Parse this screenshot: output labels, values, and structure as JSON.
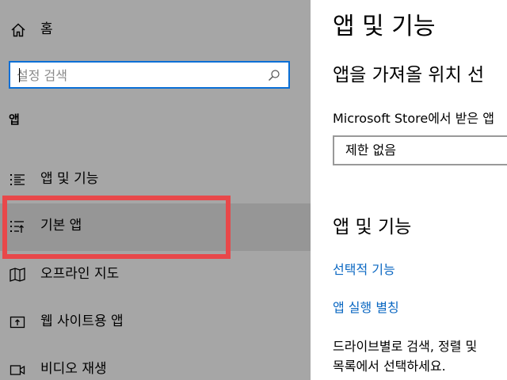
{
  "sidebar": {
    "home_label": "홈",
    "search": {
      "placeholder": "설정 검색"
    },
    "section_title": "앱",
    "items": [
      {
        "label": "앱 및 기능",
        "icon": "apps-features-icon"
      },
      {
        "label": "기본 앱",
        "icon": "default-apps-icon",
        "selected": true
      },
      {
        "label": "오프라인 지도",
        "icon": "offline-maps-icon"
      },
      {
        "label": "웹 사이트용 앱",
        "icon": "apps-for-websites-icon"
      },
      {
        "label": "비디오 재생",
        "icon": "video-playback-icon"
      }
    ]
  },
  "main": {
    "title": "앱 및 기능",
    "choose_where_heading": "앱을 가져올 위치 선",
    "store_text": "Microsoft Store에서 받은 앱",
    "dropdown_value": "제한 없음",
    "apps_features_heading": "앱 및 기능",
    "optional_features_link": "선택적 기능",
    "app_execution_alias_link": "앱 실행 별칭",
    "description_line1": "드라이브별로 검색, 정렬 및",
    "description_line2": "목록에서 선택하세요."
  },
  "colors": {
    "sidebar_bg": "#a6a6a6",
    "selected_bg": "#969696",
    "search_border": "#0a6fd6",
    "highlight": "#e8484a",
    "link": "#0a67c2"
  }
}
